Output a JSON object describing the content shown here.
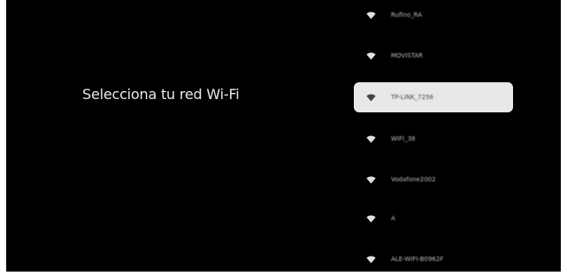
{
  "screen": {
    "background": "#000000",
    "title": "Selecciona tu red Wi-Fi"
  },
  "networks": [
    {
      "name": "Rufino_RA",
      "icon": "wifi-icon",
      "selected": false
    },
    {
      "name": "MOVISTAR",
      "icon": "wifi-icon",
      "selected": false
    },
    {
      "name": "TP-LINK_7256",
      "icon": "wifi-icon",
      "selected": true
    },
    {
      "name": "WIFI_38",
      "icon": "wifi-icon",
      "selected": false
    },
    {
      "name": "Vodafone2002",
      "icon": "wifi-icon",
      "selected": false
    },
    {
      "name": "A",
      "icon": "wifi-icon",
      "selected": false
    },
    {
      "name": "ALE-WIFI-B0962F",
      "icon": "wifi-icon",
      "selected": false
    }
  ],
  "colors": {
    "selected_background": "#e8e8e8",
    "text": "#e8e8e8",
    "item_text": "#bdbdbd"
  }
}
